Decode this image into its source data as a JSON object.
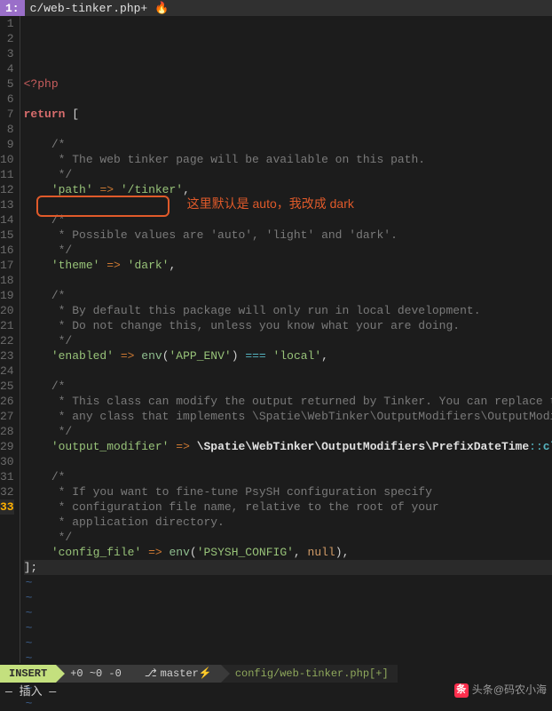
{
  "tab": {
    "index": "1:",
    "name": "c/web-tinker.php+",
    "flame": "🔥"
  },
  "lines": [
    {
      "n": 1,
      "tokens": [
        {
          "t": "<?php",
          "c": "c-tag"
        }
      ]
    },
    {
      "n": 2,
      "tokens": []
    },
    {
      "n": 3,
      "tokens": [
        {
          "t": "return",
          "c": "c-kw"
        },
        {
          "t": " ["
        }
      ]
    },
    {
      "n": 4,
      "tokens": []
    },
    {
      "n": 5,
      "tokens": [
        {
          "t": "    /*",
          "c": "c-comment"
        }
      ]
    },
    {
      "n": 6,
      "tokens": [
        {
          "t": "     * The web tinker page will be available on this path.",
          "c": "c-comment"
        }
      ]
    },
    {
      "n": 7,
      "tokens": [
        {
          "t": "     */",
          "c": "c-comment"
        }
      ]
    },
    {
      "n": 8,
      "tokens": [
        {
          "t": "    "
        },
        {
          "t": "'path'",
          "c": "c-str"
        },
        {
          "t": " "
        },
        {
          "t": "=>",
          "c": "c-arrow"
        },
        {
          "t": " "
        },
        {
          "t": "'/tinker'",
          "c": "c-str"
        },
        {
          "t": ","
        }
      ]
    },
    {
      "n": 9,
      "tokens": []
    },
    {
      "n": 10,
      "tokens": [
        {
          "t": "    /*",
          "c": "c-comment"
        }
      ]
    },
    {
      "n": 11,
      "tokens": [
        {
          "t": "     * Possible values are 'auto', 'light' and 'dark'.",
          "c": "c-comment"
        }
      ]
    },
    {
      "n": 12,
      "tokens": [
        {
          "t": "     */",
          "c": "c-comment"
        }
      ]
    },
    {
      "n": 13,
      "tokens": [
        {
          "t": "    "
        },
        {
          "t": "'theme'",
          "c": "c-str"
        },
        {
          "t": " "
        },
        {
          "t": "=>",
          "c": "c-arrow"
        },
        {
          "t": " "
        },
        {
          "t": "'dark'",
          "c": "c-str"
        },
        {
          "t": ","
        }
      ]
    },
    {
      "n": 14,
      "tokens": []
    },
    {
      "n": 15,
      "tokens": [
        {
          "t": "    /*",
          "c": "c-comment"
        }
      ]
    },
    {
      "n": 16,
      "tokens": [
        {
          "t": "     * By default this package will only run in local development.",
          "c": "c-comment"
        }
      ]
    },
    {
      "n": 17,
      "tokens": [
        {
          "t": "     * Do not change this, unless you know what your are doing.",
          "c": "c-comment"
        }
      ]
    },
    {
      "n": 18,
      "tokens": [
        {
          "t": "     */",
          "c": "c-comment"
        }
      ]
    },
    {
      "n": 19,
      "tokens": [
        {
          "t": "    "
        },
        {
          "t": "'enabled'",
          "c": "c-str"
        },
        {
          "t": " "
        },
        {
          "t": "=>",
          "c": "c-arrow"
        },
        {
          "t": " "
        },
        {
          "t": "env",
          "c": "c-func"
        },
        {
          "t": "("
        },
        {
          "t": "'APP_ENV'",
          "c": "c-str"
        },
        {
          "t": ") "
        },
        {
          "t": "===",
          "c": "c-op"
        },
        {
          "t": " "
        },
        {
          "t": "'local'",
          "c": "c-str"
        },
        {
          "t": ","
        }
      ]
    },
    {
      "n": 20,
      "tokens": []
    },
    {
      "n": 21,
      "tokens": [
        {
          "t": "    /*",
          "c": "c-comment"
        }
      ]
    },
    {
      "n": 22,
      "tokens": [
        {
          "t": "     * This class can modify the output returned by Tinker. You can replace this with",
          "c": "c-comment"
        }
      ]
    },
    {
      "n": 23,
      "tokens": [
        {
          "t": "     * any class that implements \\Spatie\\WebTinker\\OutputModifiers\\OutputModifier.",
          "c": "c-comment"
        }
      ]
    },
    {
      "n": 24,
      "tokens": [
        {
          "t": "     */",
          "c": "c-comment"
        }
      ]
    },
    {
      "n": 25,
      "tokens": [
        {
          "t": "    "
        },
        {
          "t": "'output_modifier'",
          "c": "c-str"
        },
        {
          "t": " "
        },
        {
          "t": "=>",
          "c": "c-arrow"
        },
        {
          "t": " "
        },
        {
          "t": "\\Spatie\\WebTinker\\OutputModifiers\\PrefixDateTime",
          "c": "c-ns"
        },
        {
          "t": "::",
          "c": "c-op"
        },
        {
          "t": "class",
          "c": "c-class"
        },
        {
          "t": ","
        }
      ]
    },
    {
      "n": 26,
      "tokens": []
    },
    {
      "n": 27,
      "tokens": [
        {
          "t": "    /*",
          "c": "c-comment"
        }
      ]
    },
    {
      "n": 28,
      "tokens": [
        {
          "t": "     * If you want to fine-tune PsySH configuration specify",
          "c": "c-comment"
        }
      ]
    },
    {
      "n": 29,
      "tokens": [
        {
          "t": "     * configuration file name, relative to the root of your",
          "c": "c-comment"
        }
      ]
    },
    {
      "n": 30,
      "tokens": [
        {
          "t": "     * application directory.",
          "c": "c-comment"
        }
      ]
    },
    {
      "n": 31,
      "tokens": [
        {
          "t": "     */",
          "c": "c-comment"
        }
      ]
    },
    {
      "n": 32,
      "tokens": [
        {
          "t": "    "
        },
        {
          "t": "'config_file'",
          "c": "c-str"
        },
        {
          "t": " "
        },
        {
          "t": "=>",
          "c": "c-arrow"
        },
        {
          "t": " "
        },
        {
          "t": "env",
          "c": "c-func"
        },
        {
          "t": "("
        },
        {
          "t": "'PSYSH_CONFIG'",
          "c": "c-str"
        },
        {
          "t": ", "
        },
        {
          "t": "null",
          "c": "c-null"
        },
        {
          "t": ")"
        },
        {
          "t": ","
        }
      ]
    },
    {
      "n": 33,
      "cursor": true,
      "tokens": [
        {
          "t": "];"
        }
      ]
    }
  ],
  "tildes_count": 9,
  "annotation": "这里默认是 auto，我改成 dark",
  "status": {
    "mode": "INSERT",
    "diff": "+0 ~0 -0",
    "branch_icon": "⎇",
    "branch": "master⚡",
    "file": "config/web-tinker.php[+]"
  },
  "cmdline": "— 插入 —",
  "watermark": {
    "prefix": "头条",
    "suffix": "@码农小海"
  }
}
